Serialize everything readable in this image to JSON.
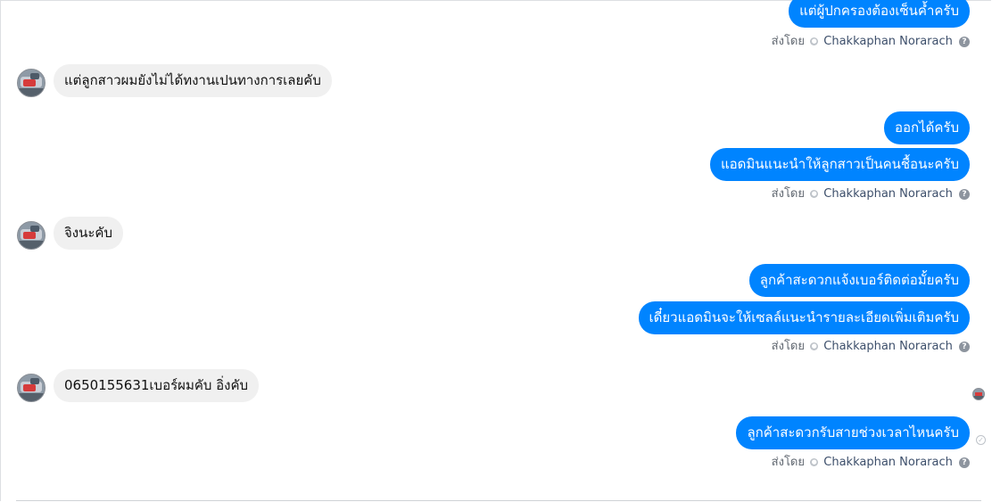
{
  "messages": {
    "m1": "แต่ผู้ปกครองต้องเซ็นค้ำครับ",
    "m2": "แต่ลูกสาวผมยังไม่ได้ทงานเปนทางการเลยคับ",
    "m3": "ออกได้ครับ",
    "m4": "แอดมินแนะนำให้ลูกสาวเป็นคนชื้อนะครับ",
    "m5": "จิงนะคับ",
    "m6": "ลูกค้าสะดวกแจ้งเบอร์ติดต่อมั้ยครับ",
    "m7": "เดี๋ยวแอดมินจะให้เซลล์แนะนำรายละเอียดเพิ่มเติมครับ",
    "m8": "0650155631เบอร์ผมคับ อิ่งคับ",
    "m9": "ลูกค้าสะดวกรับสายช่วงเวลาไหนครับ"
  },
  "meta": {
    "sent_by": "ส่งโดย",
    "sender": "Chakkaphan Norarach"
  },
  "icons": {
    "help": "help-icon",
    "sent_status": "sent-check-icon",
    "verified_dot": "page-dot-icon"
  },
  "colors": {
    "outgoing_bubble": "#0084ff",
    "incoming_bubble": "#f0f0f0"
  }
}
